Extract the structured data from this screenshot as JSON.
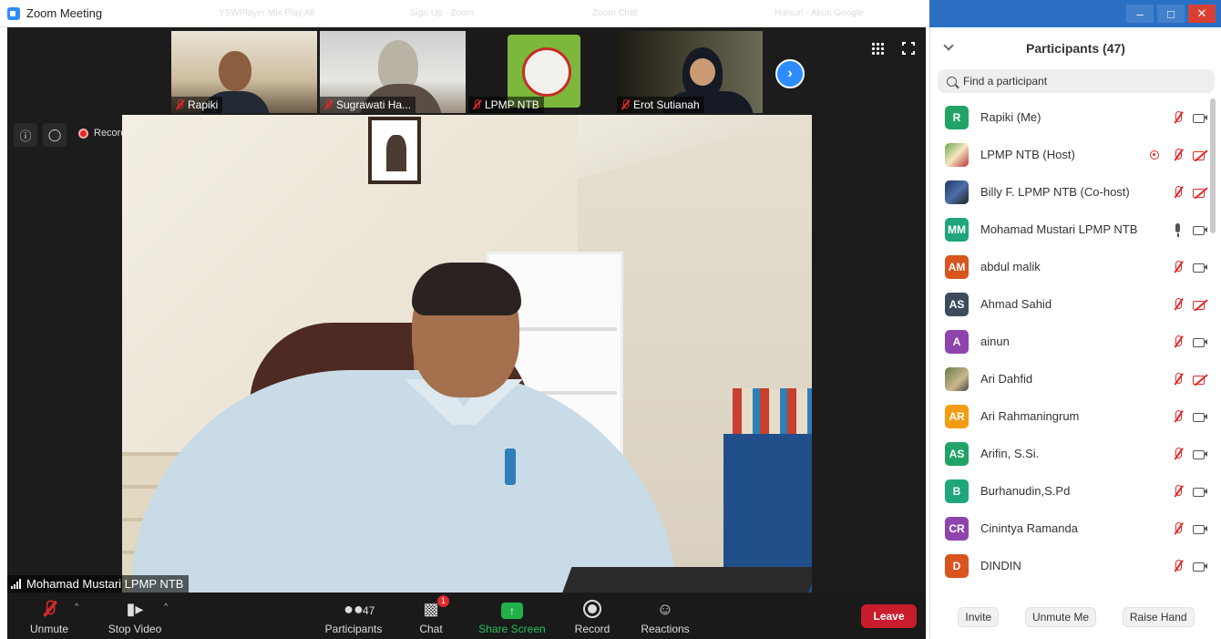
{
  "window": {
    "title": "Zoom Meeting",
    "background_tabs": [
      "YSWPlayer Mix Play All",
      "Sign Up - Zoom",
      "Zoom Chat",
      "Hatsuri - Akun Google"
    ]
  },
  "thumbnails": [
    {
      "name": "Rapiki",
      "muted": true
    },
    {
      "name": "Sugrawati Ha...",
      "muted": true
    },
    {
      "name": "LPMP NTB",
      "muted": true
    },
    {
      "name": "Erot Sutianah",
      "muted": true
    }
  ],
  "meeting": {
    "recording_label": "Recording",
    "active_speaker": "Mohamad Mustari LPMP NTB"
  },
  "toolbar": {
    "unmute": "Unmute",
    "stop_video": "Stop Video",
    "participants": "Participants",
    "participants_count": "47",
    "chat": "Chat",
    "chat_badge": "1",
    "share_screen": "Share Screen",
    "record": "Record",
    "reactions": "Reactions",
    "leave": "Leave"
  },
  "panel": {
    "title": "Participants (47)",
    "search_placeholder": "Find a participant",
    "participants": [
      {
        "name": "Rapiki (Me)",
        "initials": "R",
        "color": "#21a366",
        "mic": "off",
        "cam": "on"
      },
      {
        "name": "LPMP NTB (Host)",
        "initials": "",
        "color": "#6aa84f",
        "mic": "off",
        "cam": "off",
        "recording": true
      },
      {
        "name": "Billy F. LPMP NTB (Co-host)",
        "initials": "",
        "color": "#1f3a66",
        "mic": "off",
        "cam": "off"
      },
      {
        "name": "Mohamad Mustari LPMP NTB",
        "initials": "MM",
        "color": "#1fa67a",
        "mic": "on",
        "cam": "on"
      },
      {
        "name": "abdul malik",
        "initials": "AM",
        "color": "#d9541e",
        "mic": "off",
        "cam": "on"
      },
      {
        "name": "Ahmad Sahid",
        "initials": "AS",
        "color": "#3d4b5c",
        "mic": "off",
        "cam": "off"
      },
      {
        "name": "ainun",
        "initials": "A",
        "color": "#8e44ad",
        "mic": "off",
        "cam": "on"
      },
      {
        "name": "Ari Dahfid",
        "initials": "",
        "color": "#6b7a4e",
        "mic": "off",
        "cam": "off"
      },
      {
        "name": "Ari Rahmaningrum",
        "initials": "AR",
        "color": "#f39c12",
        "mic": "off",
        "cam": "on"
      },
      {
        "name": "Arifin, S.Si.",
        "initials": "AS",
        "color": "#21a366",
        "mic": "off",
        "cam": "on"
      },
      {
        "name": "Burhanudin,S.Pd",
        "initials": "B",
        "color": "#1fa67a",
        "mic": "off",
        "cam": "on"
      },
      {
        "name": "Cinintya Ramanda",
        "initials": "CR",
        "color": "#8e44ad",
        "mic": "off",
        "cam": "on"
      },
      {
        "name": "DINDIN",
        "initials": "D",
        "color": "#d9541e",
        "mic": "off",
        "cam": "on"
      }
    ],
    "invite": "Invite",
    "unmute_me": "Unmute Me",
    "raise_hand": "Raise Hand"
  }
}
